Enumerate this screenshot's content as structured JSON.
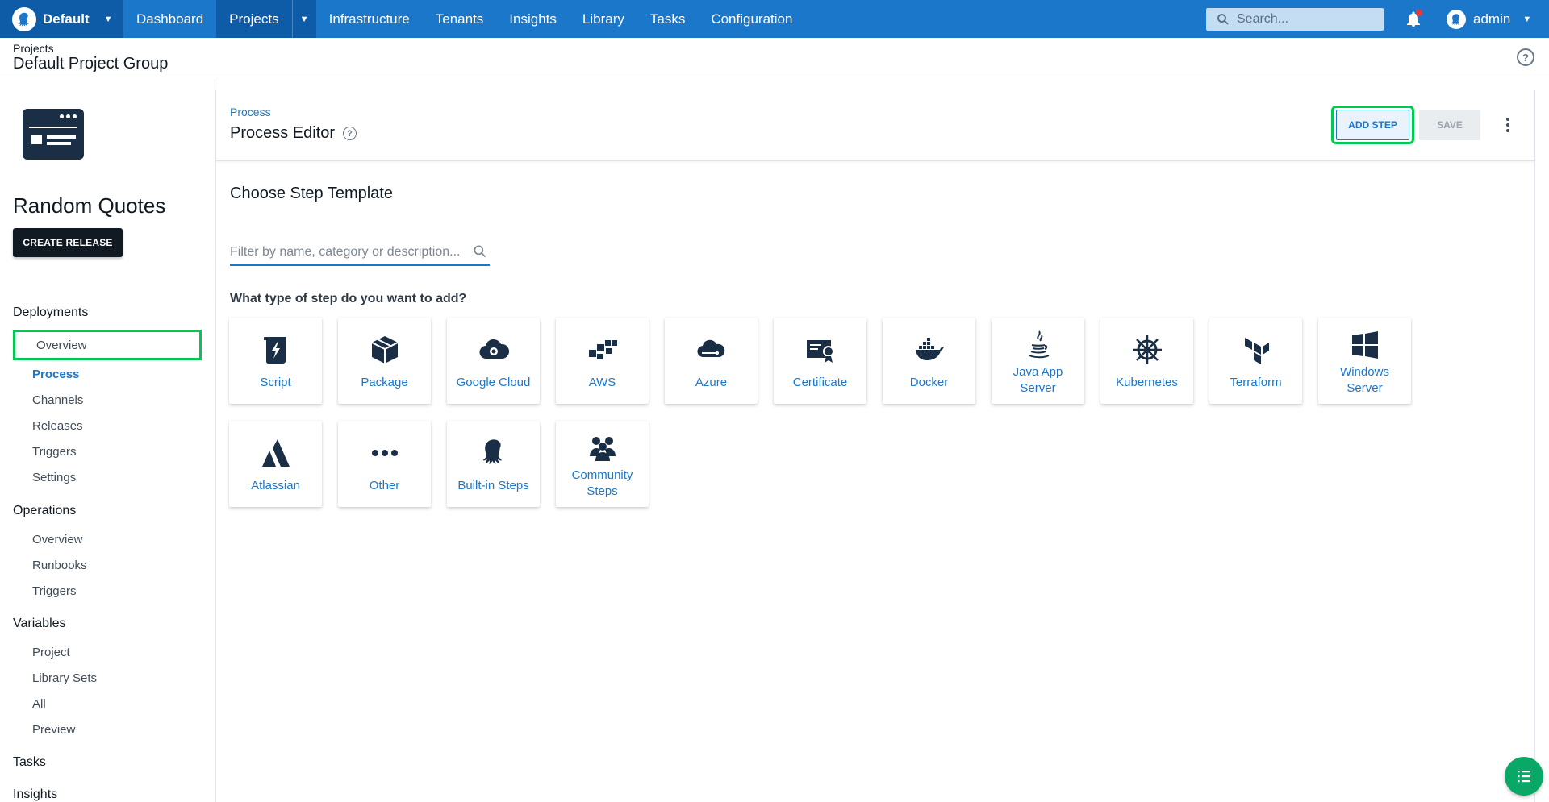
{
  "nav": {
    "space": "Default",
    "items": [
      "Dashboard",
      "Projects",
      "Infrastructure",
      "Tenants",
      "Insights",
      "Library",
      "Tasks",
      "Configuration"
    ],
    "search_placeholder": "Search...",
    "user": "admin"
  },
  "header": {
    "breadcrumb": "Projects",
    "title": "Default Project Group"
  },
  "sidebar": {
    "project_name": "Random Quotes",
    "create_release": "CREATE RELEASE",
    "sections": [
      {
        "title": "Deployments",
        "items": [
          "Overview",
          "Process",
          "Channels",
          "Releases",
          "Triggers",
          "Settings"
        ]
      },
      {
        "title": "Operations",
        "items": [
          "Overview",
          "Runbooks",
          "Triggers"
        ]
      },
      {
        "title": "Variables",
        "items": [
          "Project",
          "Library Sets",
          "All",
          "Preview"
        ]
      },
      {
        "title": "Tasks",
        "items": []
      },
      {
        "title": "Insights",
        "items": []
      }
    ]
  },
  "main": {
    "breadcrumb": "Process",
    "title": "Process Editor",
    "add_step": "ADD STEP",
    "save": "SAVE",
    "choose_title": "Choose Step Template",
    "filter_placeholder": "Filter by name, category or description...",
    "question": "What type of step do you want to add?",
    "tiles": [
      "Script",
      "Package",
      "Google Cloud",
      "AWS",
      "Azure",
      "Certificate",
      "Docker",
      "Java App Server",
      "Kubernetes",
      "Terraform",
      "Windows Server",
      "Atlassian",
      "Other",
      "Built-in Steps",
      "Community Steps"
    ]
  },
  "icons": [
    "octopus-logo",
    "search-icon",
    "bell-icon",
    "help-icon",
    "kebab-icon",
    "script-icon",
    "package-icon",
    "google-cloud-icon",
    "aws-icon",
    "azure-icon",
    "certificate-icon",
    "docker-icon",
    "java-icon",
    "kubernetes-icon",
    "terraform-icon",
    "windows-icon",
    "atlassian-icon",
    "other-icon",
    "octopus-icon",
    "community-icon",
    "list-icon"
  ],
  "colors": {
    "brand": "#1a77ca",
    "nav_active": "#0e5ca8",
    "highlight": "#00c853",
    "dark": "#111a23",
    "fab": "#0aa866"
  }
}
